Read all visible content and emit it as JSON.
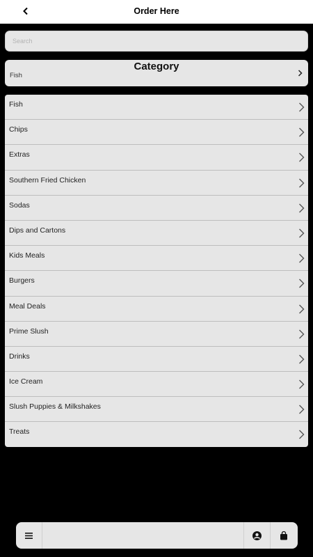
{
  "header": {
    "title": "Order Here",
    "back_icon": "chevron-left-icon"
  },
  "search": {
    "placeholder": "Search",
    "value": ""
  },
  "category": {
    "heading": "Category",
    "selected": "Fish"
  },
  "categories": [
    {
      "label": "Fish"
    },
    {
      "label": "Chips"
    },
    {
      "label": "Extras"
    },
    {
      "label": "Southern Fried Chicken"
    },
    {
      "label": "Sodas"
    },
    {
      "label": "Dips and Cartons"
    },
    {
      "label": "Kids Meals"
    },
    {
      "label": "Burgers"
    },
    {
      "label": "Meal Deals"
    },
    {
      "label": "Prime Slush"
    },
    {
      "label": "Drinks"
    },
    {
      "label": "Ice Cream"
    },
    {
      "label": "Slush Puppies & Milkshakes"
    },
    {
      "label": "Treats"
    }
  ],
  "bottom_nav": {
    "menu_icon": "hamburger-menu-icon",
    "account_icon": "user-circle-icon",
    "basket_icon": "shopping-bag-icon"
  },
  "colors": {
    "background": "#000000",
    "panel": "#e6e6e6",
    "header": "#ffffff"
  }
}
